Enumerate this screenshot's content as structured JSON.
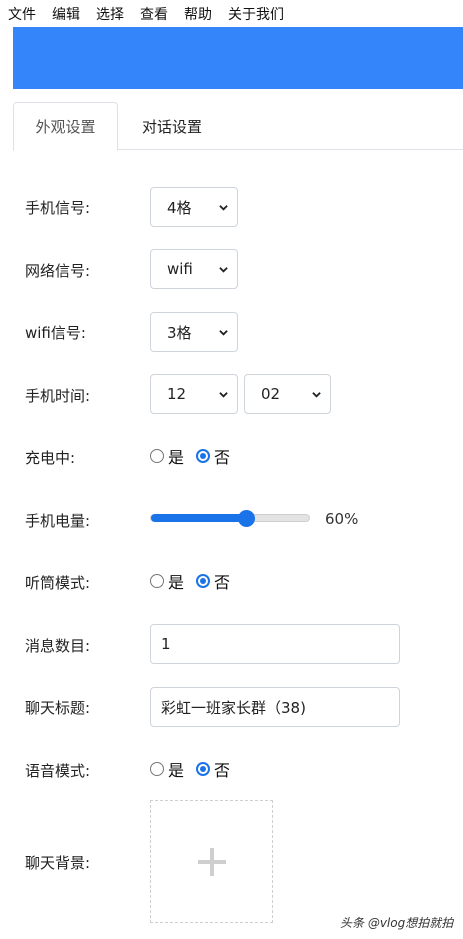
{
  "menubar": {
    "items": [
      "文件",
      "编辑",
      "选择",
      "查看",
      "帮助",
      "关于我们"
    ]
  },
  "colors": {
    "banner": "#3585fa",
    "accent": "#1a73e8"
  },
  "tabs": [
    {
      "label": "外观设置",
      "active": true
    },
    {
      "label": "对话设置",
      "active": false
    }
  ],
  "form": {
    "signal": {
      "label": "手机信号:",
      "value": "4格"
    },
    "network": {
      "label": "网络信号:",
      "value": "wifi"
    },
    "wifi": {
      "label": "wifi信号:",
      "value": "3格"
    },
    "time": {
      "label": "手机时间:",
      "hour": "12",
      "minute": "02"
    },
    "charging": {
      "label": "充电中:",
      "options": [
        "是",
        "否"
      ],
      "selected": "否"
    },
    "battery": {
      "label": "手机电量:",
      "percent": 60,
      "display": "60%"
    },
    "earpiece": {
      "label": "听筒模式:",
      "options": [
        "是",
        "否"
      ],
      "selected": "否"
    },
    "message_count": {
      "label": "消息数目:",
      "value": "1"
    },
    "chat_title": {
      "label": "聊天标题:",
      "value": "彩虹一班家长群（38)"
    },
    "voice_mode": {
      "label": "语音模式:",
      "options": [
        "是",
        "否"
      ],
      "selected": "否"
    },
    "chat_background": {
      "label": "聊天背景:",
      "icon": "plus-icon"
    }
  },
  "watermark": "头条 @vlog想拍就拍"
}
